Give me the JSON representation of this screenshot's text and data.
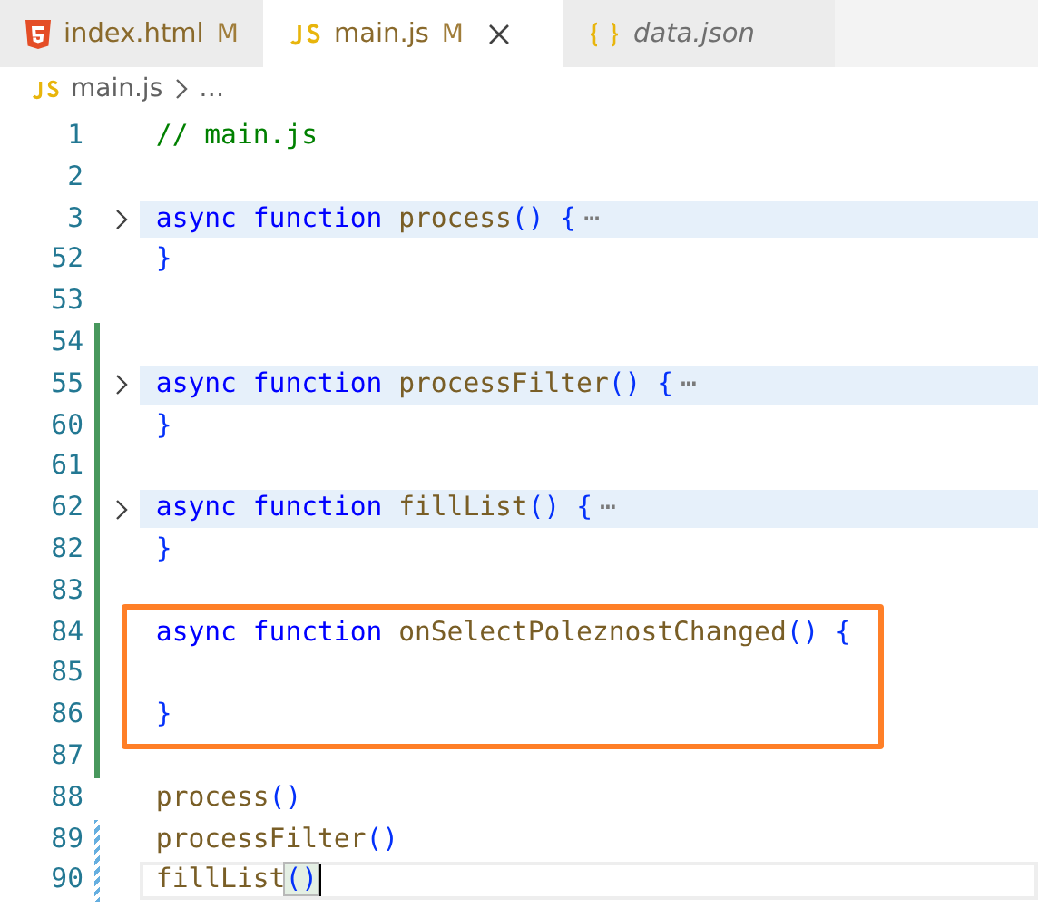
{
  "tabs": [
    {
      "kind": "html",
      "label": "index.html",
      "modified": true,
      "badge": "M",
      "preview": false,
      "selected": false
    },
    {
      "kind": "js",
      "label": "main.js",
      "modified": true,
      "badge": "M",
      "preview": false,
      "selected": true
    },
    {
      "kind": "json",
      "label": "data.json",
      "modified": false,
      "preview": true,
      "selected": false
    }
  ],
  "breadcrumb": {
    "file": "main.js",
    "rest": "…"
  },
  "lines": [
    {
      "number": "1",
      "added": false,
      "modified": false,
      "folded": false,
      "boxed": false,
      "current": false,
      "tokens": [
        {
          "kind": "comment",
          "text": "// main.js"
        }
      ]
    },
    {
      "number": "2",
      "added": false,
      "modified": false,
      "folded": false,
      "boxed": false,
      "current": false
    },
    {
      "number": "3",
      "added": false,
      "modified": false,
      "folded": true,
      "boxed": false,
      "current": false,
      "tokens": [
        {
          "kind": "keyword",
          "text": "async function "
        },
        {
          "kind": "name",
          "text": "process"
        },
        {
          "kind": "punct",
          "text": "() {"
        },
        {
          "kind": "ellipsis",
          "text": "⋯"
        }
      ]
    },
    {
      "number": "52",
      "added": false,
      "modified": false,
      "folded": false,
      "boxed": false,
      "current": false,
      "tokens": [
        {
          "kind": "punct",
          "text": "}"
        }
      ]
    },
    {
      "number": "53",
      "added": false,
      "modified": false,
      "folded": false,
      "boxed": false,
      "current": false
    },
    {
      "number": "54",
      "added": true,
      "modified": false,
      "folded": false,
      "boxed": false,
      "current": false
    },
    {
      "number": "55",
      "added": true,
      "modified": false,
      "folded": true,
      "boxed": false,
      "current": false,
      "tokens": [
        {
          "kind": "keyword",
          "text": "async function "
        },
        {
          "kind": "name",
          "text": "processFilter"
        },
        {
          "kind": "punct",
          "text": "() {"
        },
        {
          "kind": "ellipsis",
          "text": "⋯"
        }
      ]
    },
    {
      "number": "60",
      "added": true,
      "modified": false,
      "folded": false,
      "boxed": false,
      "current": false,
      "tokens": [
        {
          "kind": "punct",
          "text": "}"
        }
      ]
    },
    {
      "number": "61",
      "added": true,
      "modified": false,
      "folded": false,
      "boxed": false,
      "current": false
    },
    {
      "number": "62",
      "added": true,
      "modified": false,
      "folded": true,
      "boxed": false,
      "current": false,
      "tokens": [
        {
          "kind": "keyword",
          "text": "async function "
        },
        {
          "kind": "name",
          "text": "fillList"
        },
        {
          "kind": "punct",
          "text": "() {"
        },
        {
          "kind": "ellipsis",
          "text": "⋯"
        }
      ]
    },
    {
      "number": "82",
      "added": true,
      "modified": false,
      "folded": false,
      "boxed": false,
      "current": false,
      "tokens": [
        {
          "kind": "punct",
          "text": "}"
        }
      ]
    },
    {
      "number": "83",
      "added": true,
      "modified": false,
      "folded": false,
      "boxed": false,
      "current": false
    },
    {
      "number": "84",
      "added": true,
      "modified": false,
      "folded": false,
      "boxed": true,
      "current": false,
      "tokens": [
        {
          "kind": "keyword",
          "text": "async function "
        },
        {
          "kind": "name",
          "text": "onSelectPoleznostChanged"
        },
        {
          "kind": "punct",
          "text": "() {"
        }
      ]
    },
    {
      "number": "85",
      "added": true,
      "modified": false,
      "folded": false,
      "boxed": true,
      "current": false
    },
    {
      "number": "86",
      "added": true,
      "modified": false,
      "folded": false,
      "boxed": true,
      "current": false,
      "tokens": [
        {
          "kind": "punct",
          "text": "}"
        }
      ]
    },
    {
      "number": "87",
      "added": true,
      "modified": false,
      "folded": false,
      "boxed": false,
      "current": false
    },
    {
      "number": "88",
      "added": false,
      "modified": false,
      "folded": false,
      "boxed": false,
      "current": false,
      "tokens": [
        {
          "kind": "name",
          "text": "process"
        },
        {
          "kind": "punct",
          "text": "()"
        }
      ]
    },
    {
      "number": "89",
      "added": false,
      "modified": true,
      "folded": false,
      "boxed": false,
      "current": false,
      "tokens": [
        {
          "kind": "name",
          "text": "processFilter"
        },
        {
          "kind": "punct",
          "text": "()"
        }
      ]
    },
    {
      "number": "90",
      "added": false,
      "modified": true,
      "folded": false,
      "boxed": false,
      "current": true,
      "tokens": [
        {
          "kind": "name",
          "text": "fillList"
        },
        {
          "kind": "bracket-match",
          "text": "()"
        }
      ]
    }
  ]
}
